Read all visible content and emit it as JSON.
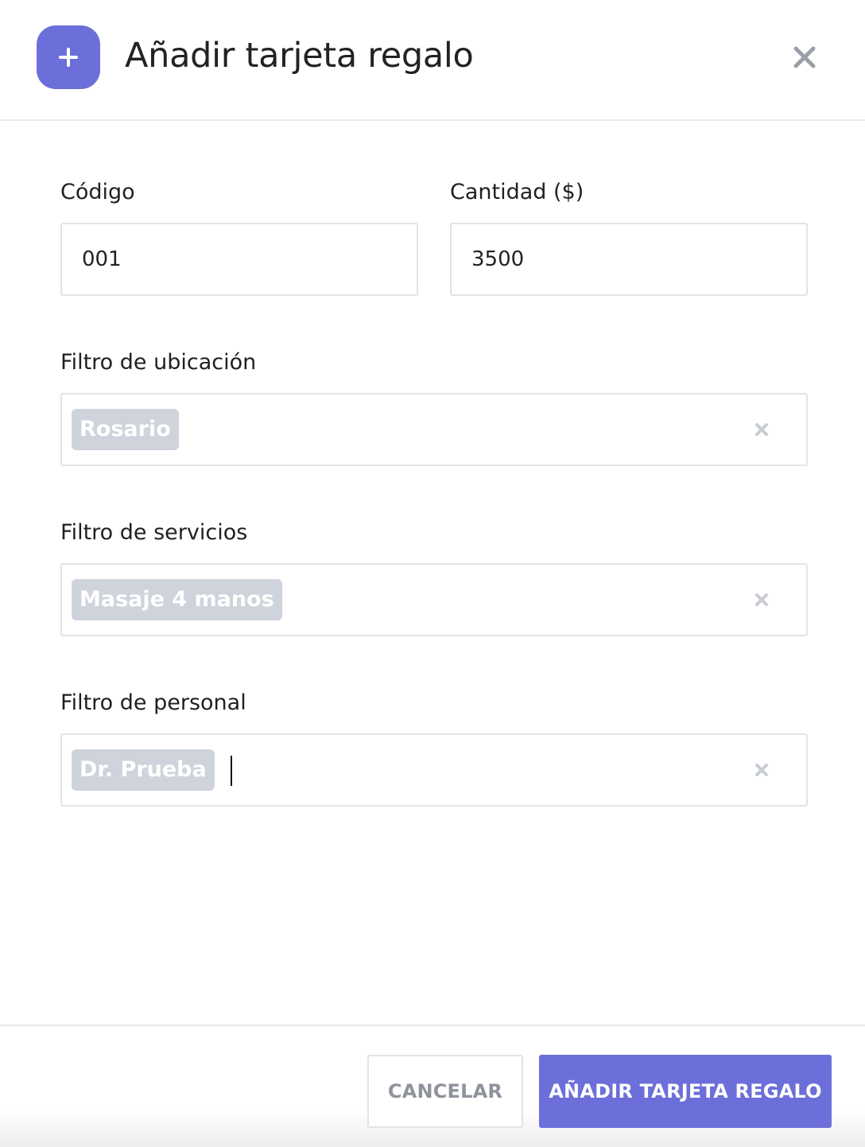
{
  "dialog": {
    "title": "Añadir tarjeta regalo",
    "header_icon": "plus-icon",
    "close_icon": "close-icon"
  },
  "form": {
    "code": {
      "label": "Código",
      "value": "001"
    },
    "amount": {
      "label": "Cantidad ($)",
      "value": "3500"
    },
    "location_filter": {
      "label": "Filtro de ubicación",
      "tags": [
        "Rosario"
      ],
      "clear_icon": "clear-icon"
    },
    "services_filter": {
      "label": "Filtro de servicios",
      "tags": [
        "Masaje 4 manos"
      ],
      "clear_icon": "clear-icon"
    },
    "staff_filter": {
      "label": "Filtro de personal",
      "tags": [
        "Dr. Prueba"
      ],
      "clear_icon": "clear-icon",
      "focused": true
    }
  },
  "footer": {
    "cancel_label": "CANCELAR",
    "submit_label": "AÑADIR TARJETA REGALO"
  },
  "colors": {
    "accent": "#6c6fd9",
    "tag_background": "#cfd3dc",
    "border": "#e1e3e9",
    "muted_text": "#8e939c"
  }
}
